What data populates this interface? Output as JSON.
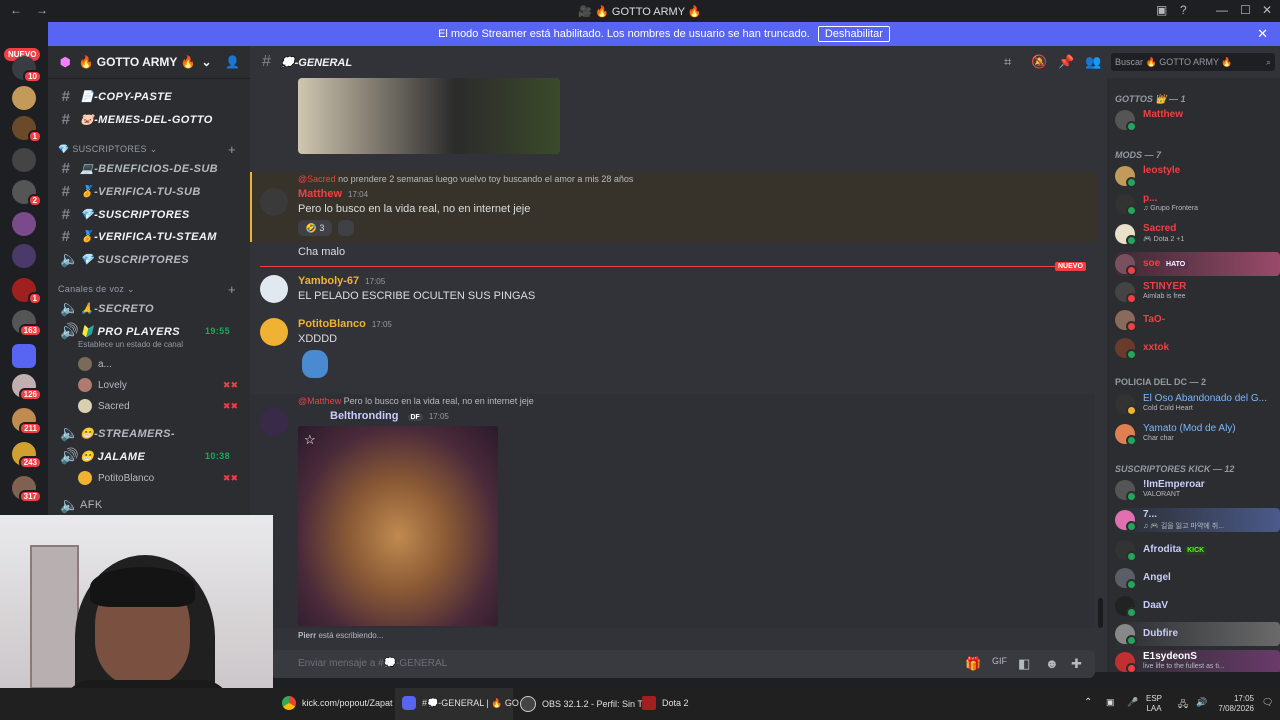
{
  "window": {
    "title": "🎥 🔥 GOTTO ARMY 🔥"
  },
  "banner": {
    "text": "El modo Streamer está habilitado. Los nombres de usuario se han truncado.",
    "button": "Deshabilitar"
  },
  "rail": {
    "nuevo": "NUEVO",
    "badges": [
      "10",
      "1",
      "2",
      "1",
      "163",
      "126",
      "211",
      "243",
      "317"
    ]
  },
  "guild": {
    "name": "🔥 GOTTO ARMY 🔥"
  },
  "channels": {
    "top": [
      "📄-COPY-PASTE",
      "🐷-MEMES-DEL-GOTTO"
    ],
    "cat_subs": "SUSCRIPTORES",
    "subs": [
      "💻-BENEFICIOS-DE-SUB",
      "🏅-VERIFICA-TU-SUB",
      "💎-SUSCRIPTORES",
      "🏅-VERIFICA-TU-STEAM",
      "💎 SUSCRIPTORES"
    ],
    "cat_voice": "Canales de voz",
    "voice": [
      {
        "name": "🙏-SECRETO"
      },
      {
        "name": "🔰 PRO PLAYERS",
        "timer": "19:55",
        "status": "Establece un estado de canal"
      },
      {
        "name": "😁-STREAMERS-"
      },
      {
        "name": "😁 JALAME",
        "timer": "10:38"
      },
      {
        "name": "AFK"
      }
    ],
    "voice_users": [
      "a...",
      "Lovely",
      "Sacred",
      "PotitoBlanco"
    ]
  },
  "chat": {
    "channel": "💭-GENERAL",
    "reply1": "no prendere 2 semanas luego vuelvo toy buscando el amor a mis 28 años",
    "reply1_to": "@Sacred",
    "m1_user": "Matthew",
    "m1_time": "17:04",
    "m1_text": "Pero lo busco en la vida real, no en internet jeje",
    "m1_react": "3",
    "m1_text2": "Cha malo",
    "new_label": "NUEVO",
    "m2_user": "Yamboly-67",
    "m2_time": "17:05",
    "m2_text": "EL PELADO ESCRIBE OCULTEN SUS PINGAS",
    "m3_user": "PotitoBlanco",
    "m3_time": "17:05",
    "m3_text": "XDDDD",
    "reply2_to": "@Matthew",
    "reply2": "Pero lo busco en la vida real, no en internet jeje",
    "m4_user": "Belthronding",
    "m4_tag": "DF",
    "m4_time": "17:05",
    "typing_user": "Pierr",
    "typing_text": "está escribiendo...",
    "composer": "Enviar mensaje a #💭-GENERAL",
    "search": "Buscar 🔥 GOTTO ARMY 🔥"
  },
  "members": {
    "cats": [
      "GOTTOS 👑 — 1",
      "MODS — 7",
      "POLICIA DEL DC — 2",
      "SUSCRIPTORES KICK — 12"
    ],
    "gottos": [
      {
        "name": "Matthew",
        "color": "#f23f43"
      }
    ],
    "mods": [
      {
        "name": "leostyle",
        "color": "#f23f43",
        "sub": ""
      },
      {
        "name": "p...",
        "color": "#f23f43",
        "sub": "♫ Grupo Frontera"
      },
      {
        "name": "Sacred",
        "color": "#f23f43",
        "sub": "🎮 Dota 2 +1"
      },
      {
        "name": "soe",
        "color": "#f23f43",
        "sub": "",
        "tag": "HATO"
      },
      {
        "name": "STINYER",
        "color": "#f23f43",
        "sub": "Aimlab is free"
      },
      {
        "name": "TaO-",
        "color": "#f23f43",
        "sub": ""
      },
      {
        "name": "xxtok",
        "color": "#f23f43",
        "sub": ""
      }
    ],
    "police": [
      {
        "name": "El Oso Abandonado del G...",
        "color": "#7ab8ff",
        "sub": "Cold Cold Heart"
      },
      {
        "name": "Yamato (Mod de Aly)",
        "color": "#7ab8ff",
        "sub": "Char char"
      }
    ],
    "kick": [
      {
        "name": "!ImEmperoar",
        "color": "#c9cdfb",
        "sub": "VALORANT"
      },
      {
        "name": "7...",
        "color": "#c9cdfb",
        "sub": "♫ 🎮 길을 잃고 마약에 취..."
      },
      {
        "name": "Afrodita",
        "color": "#c9cdfb",
        "sub": "",
        "tag": "KICK"
      },
      {
        "name": "Angel",
        "color": "#c9cdfb",
        "sub": ""
      },
      {
        "name": "DaaV",
        "color": "#c9cdfb",
        "sub": ""
      },
      {
        "name": "Dubfire",
        "color": "#c9cdfb",
        "sub": ""
      },
      {
        "name": "E1sydeonS",
        "color": "#c9cdfb",
        "sub": "live life to the fullest as ti..."
      }
    ]
  },
  "taskbar": {
    "items": [
      "kick.com/popout/Zapat",
      "#💭-GENERAL | 🔥 GO",
      "OBS 32.1.2 - Perfil: Sin Tí",
      "Dota 2"
    ],
    "lang": "ESP",
    "lang2": "LAA",
    "time": "17:05",
    "date": "7/08/2026"
  },
  "colors": {
    "accent": "#5865f2",
    "mention_bg": "#38332a",
    "red": "#f23f43",
    "green": "#23a55a"
  }
}
